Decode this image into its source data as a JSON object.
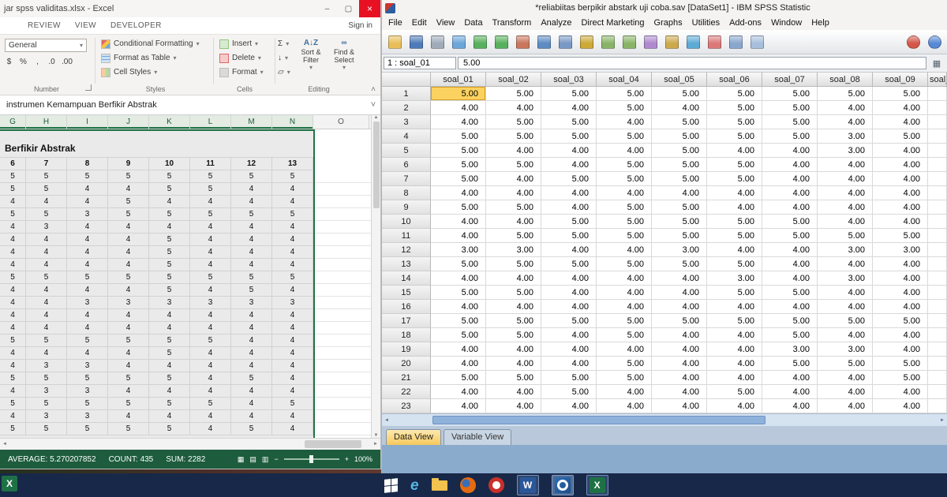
{
  "excel": {
    "title": "jar spss validitas.xlsx - Excel",
    "window_controls": {
      "minimize": "–",
      "restore": "▢",
      "close": "×"
    },
    "ribbon_tabs": [
      "REVIEW",
      "VIEW",
      "DEVELOPER"
    ],
    "sign_in": "Sign in",
    "ribbon": {
      "number_format": "General",
      "dropdown_glyph": "▾",
      "number_buttons": [
        "$",
        "%",
        ",",
        ".0",
        ".00"
      ],
      "number_group": "Number",
      "styles": [
        "Conditional Formatting",
        "Format as Table",
        "Cell Styles"
      ],
      "styles_group": "Styles",
      "cells": [
        "Insert",
        "Delete",
        "Format"
      ],
      "cells_group": "Cells",
      "editing_small": [
        "Σ",
        "↓",
        "▱"
      ],
      "sort_icon": "A↓Z",
      "find_icon": "∞",
      "sort_filter": "Sort & Filter",
      "find_select": "Find & Select",
      "editing_group": "Editing",
      "collapse_glyph": "˄"
    },
    "formula_bar": "instrumen Kemampuan Berfikir Abstrak",
    "formula_dropdown": "˅",
    "columns": [
      "G",
      "H",
      "I",
      "J",
      "K",
      "L",
      "M",
      "N",
      "O"
    ],
    "merged_title": "Berfikir Abstrak",
    "header_row": [
      "6",
      "7",
      "8",
      "9",
      "10",
      "11",
      "12",
      "13"
    ],
    "rows": [
      [
        5,
        5,
        5,
        5,
        5,
        5,
        5,
        5
      ],
      [
        5,
        5,
        4,
        4,
        5,
        5,
        4,
        4
      ],
      [
        4,
        4,
        4,
        5,
        4,
        4,
        4,
        4
      ],
      [
        5,
        5,
        3,
        5,
        5,
        5,
        5,
        5
      ],
      [
        4,
        3,
        4,
        4,
        4,
        4,
        4,
        4
      ],
      [
        4,
        4,
        4,
        4,
        5,
        4,
        4,
        4
      ],
      [
        4,
        4,
        4,
        4,
        5,
        4,
        4,
        4
      ],
      [
        4,
        4,
        4,
        4,
        5,
        4,
        4,
        4
      ],
      [
        5,
        5,
        5,
        5,
        5,
        5,
        5,
        5
      ],
      [
        4,
        4,
        4,
        4,
        5,
        4,
        5,
        4
      ],
      [
        4,
        4,
        3,
        3,
        3,
        3,
        3,
        3
      ],
      [
        4,
        4,
        4,
        4,
        4,
        4,
        4,
        4
      ],
      [
        4,
        4,
        4,
        4,
        4,
        4,
        4,
        4
      ],
      [
        5,
        5,
        5,
        5,
        5,
        5,
        4,
        4
      ],
      [
        4,
        4,
        4,
        4,
        5,
        4,
        4,
        4
      ],
      [
        4,
        3,
        3,
        4,
        4,
        4,
        4,
        4
      ],
      [
        5,
        5,
        5,
        5,
        5,
        4,
        5,
        4
      ],
      [
        4,
        3,
        3,
        4,
        4,
        4,
        4,
        4
      ],
      [
        5,
        5,
        5,
        5,
        5,
        5,
        4,
        5
      ],
      [
        4,
        3,
        3,
        4,
        4,
        4,
        4,
        4
      ],
      [
        5,
        5,
        5,
        5,
        5,
        4,
        5,
        4
      ]
    ],
    "scroll": {
      "up": "▲",
      "down": "▼",
      "left": "◄",
      "right": "►"
    },
    "status": {
      "average": "AVERAGE: 5.270207852",
      "count": "COUNT: 435",
      "sum": "SUM: 2282",
      "view_icons": [
        "▦",
        "▤",
        "▥"
      ],
      "zoom_minus": "−",
      "zoom_plus": "+",
      "zoom": "100%"
    }
  },
  "spss": {
    "title": "*reliabiitas berpikir abstark uji coba.sav [DataSet1] - IBM SPSS Statistic",
    "menus": [
      "File",
      "Edit",
      "View",
      "Data",
      "Transform",
      "Analyze",
      "Direct Marketing",
      "Graphs",
      "Utilities",
      "Add-ons",
      "Window",
      "Help"
    ],
    "toolbar_icons": [
      {
        "name": "open-data-icon",
        "color": "#e6b94d"
      },
      {
        "name": "save-icon",
        "color": "#3f6fb4"
      },
      {
        "name": "print-icon",
        "color": "#98a4b2"
      },
      {
        "name": "recall-dialogs-icon",
        "color": "#5f9ed6"
      },
      {
        "name": "undo-icon",
        "color": "#49a94f"
      },
      {
        "name": "redo-icon",
        "color": "#49a94f"
      },
      {
        "name": "goto-case-icon",
        "color": "#c46a4f"
      },
      {
        "name": "goto-variable-icon",
        "color": "#4f81bd"
      },
      {
        "name": "variables-icon",
        "color": "#6d8fc0"
      },
      {
        "name": "find-icon",
        "color": "#c9a227"
      },
      {
        "name": "insert-cases-icon",
        "color": "#7fae5a"
      },
      {
        "name": "insert-variable-icon",
        "color": "#7fae5a"
      },
      {
        "name": "split-file-icon",
        "color": "#a77fc9"
      },
      {
        "name": "weight-cases-icon",
        "color": "#c9a23d"
      },
      {
        "name": "select-cases-icon",
        "color": "#4fa3d1"
      },
      {
        "name": "value-labels-icon",
        "color": "#d96d6d"
      },
      {
        "name": "use-variable-sets-icon",
        "color": "#7f9fc9"
      },
      {
        "name": "show-all-variables-icon",
        "color": "#9fb9d9"
      }
    ],
    "toolbar_right_icons": [
      {
        "name": "spell-check-icon",
        "color": "#d04a3a"
      },
      {
        "name": "help-icon",
        "color": "#4a7fd0"
      }
    ],
    "cell_ref": "1 : soal_01",
    "cell_value": "5.00",
    "cellbar_button_glyph": "▦",
    "columns": [
      "soal_01",
      "soal_02",
      "soal_03",
      "soal_04",
      "soal_05",
      "soal_06",
      "soal_07",
      "soal_08",
      "soal_09",
      "soal_"
    ],
    "selected": {
      "row_index": 0,
      "col_index": 0
    },
    "rows": [
      [
        "5.00",
        "5.00",
        "5.00",
        "5.00",
        "5.00",
        "5.00",
        "5.00",
        "5.00",
        "5.00"
      ],
      [
        "4.00",
        "4.00",
        "4.00",
        "5.00",
        "4.00",
        "5.00",
        "5.00",
        "4.00",
        "4.00"
      ],
      [
        "4.00",
        "5.00",
        "5.00",
        "4.00",
        "5.00",
        "5.00",
        "5.00",
        "4.00",
        "4.00"
      ],
      [
        "5.00",
        "5.00",
        "5.00",
        "5.00",
        "5.00",
        "5.00",
        "5.00",
        "3.00",
        "5.00"
      ],
      [
        "5.00",
        "4.00",
        "4.00",
        "4.00",
        "5.00",
        "4.00",
        "4.00",
        "3.00",
        "4.00"
      ],
      [
        "5.00",
        "5.00",
        "4.00",
        "5.00",
        "5.00",
        "5.00",
        "4.00",
        "4.00",
        "4.00"
      ],
      [
        "5.00",
        "4.00",
        "5.00",
        "5.00",
        "5.00",
        "5.00",
        "4.00",
        "4.00",
        "4.00"
      ],
      [
        "4.00",
        "4.00",
        "4.00",
        "4.00",
        "4.00",
        "4.00",
        "4.00",
        "4.00",
        "4.00"
      ],
      [
        "5.00",
        "5.00",
        "4.00",
        "5.00",
        "5.00",
        "4.00",
        "4.00",
        "4.00",
        "4.00"
      ],
      [
        "4.00",
        "4.00",
        "5.00",
        "5.00",
        "5.00",
        "5.00",
        "5.00",
        "4.00",
        "4.00"
      ],
      [
        "4.00",
        "5.00",
        "5.00",
        "5.00",
        "5.00",
        "5.00",
        "5.00",
        "5.00",
        "5.00"
      ],
      [
        "3.00",
        "3.00",
        "4.00",
        "4.00",
        "3.00",
        "4.00",
        "4.00",
        "3.00",
        "3.00"
      ],
      [
        "5.00",
        "5.00",
        "5.00",
        "5.00",
        "5.00",
        "5.00",
        "4.00",
        "4.00",
        "4.00"
      ],
      [
        "4.00",
        "4.00",
        "4.00",
        "4.00",
        "4.00",
        "3.00",
        "4.00",
        "3.00",
        "4.00"
      ],
      [
        "5.00",
        "5.00",
        "4.00",
        "4.00",
        "4.00",
        "5.00",
        "5.00",
        "4.00",
        "4.00"
      ],
      [
        "4.00",
        "4.00",
        "4.00",
        "4.00",
        "4.00",
        "4.00",
        "4.00",
        "4.00",
        "4.00"
      ],
      [
        "5.00",
        "5.00",
        "5.00",
        "5.00",
        "5.00",
        "5.00",
        "5.00",
        "5.00",
        "5.00"
      ],
      [
        "5.00",
        "5.00",
        "4.00",
        "5.00",
        "4.00",
        "4.00",
        "5.00",
        "4.00",
        "4.00"
      ],
      [
        "4.00",
        "4.00",
        "4.00",
        "4.00",
        "4.00",
        "4.00",
        "3.00",
        "3.00",
        "4.00"
      ],
      [
        "4.00",
        "4.00",
        "4.00",
        "5.00",
        "4.00",
        "4.00",
        "5.00",
        "5.00",
        "5.00"
      ],
      [
        "5.00",
        "5.00",
        "5.00",
        "5.00",
        "4.00",
        "4.00",
        "4.00",
        "4.00",
        "5.00"
      ],
      [
        "4.00",
        "4.00",
        "5.00",
        "4.00",
        "4.00",
        "5.00",
        "4.00",
        "4.00",
        "4.00"
      ],
      [
        "4.00",
        "4.00",
        "4.00",
        "4.00",
        "4.00",
        "4.00",
        "4.00",
        "4.00",
        "4.00"
      ]
    ],
    "scroll_left": "◄",
    "scroll_right": "►",
    "tabs": [
      {
        "label": "Data View",
        "active": true
      },
      {
        "label": "Variable View",
        "active": false
      }
    ]
  },
  "taskbar": {
    "ie_letter": "e",
    "word_letter": "W",
    "excel_letter": "X"
  }
}
